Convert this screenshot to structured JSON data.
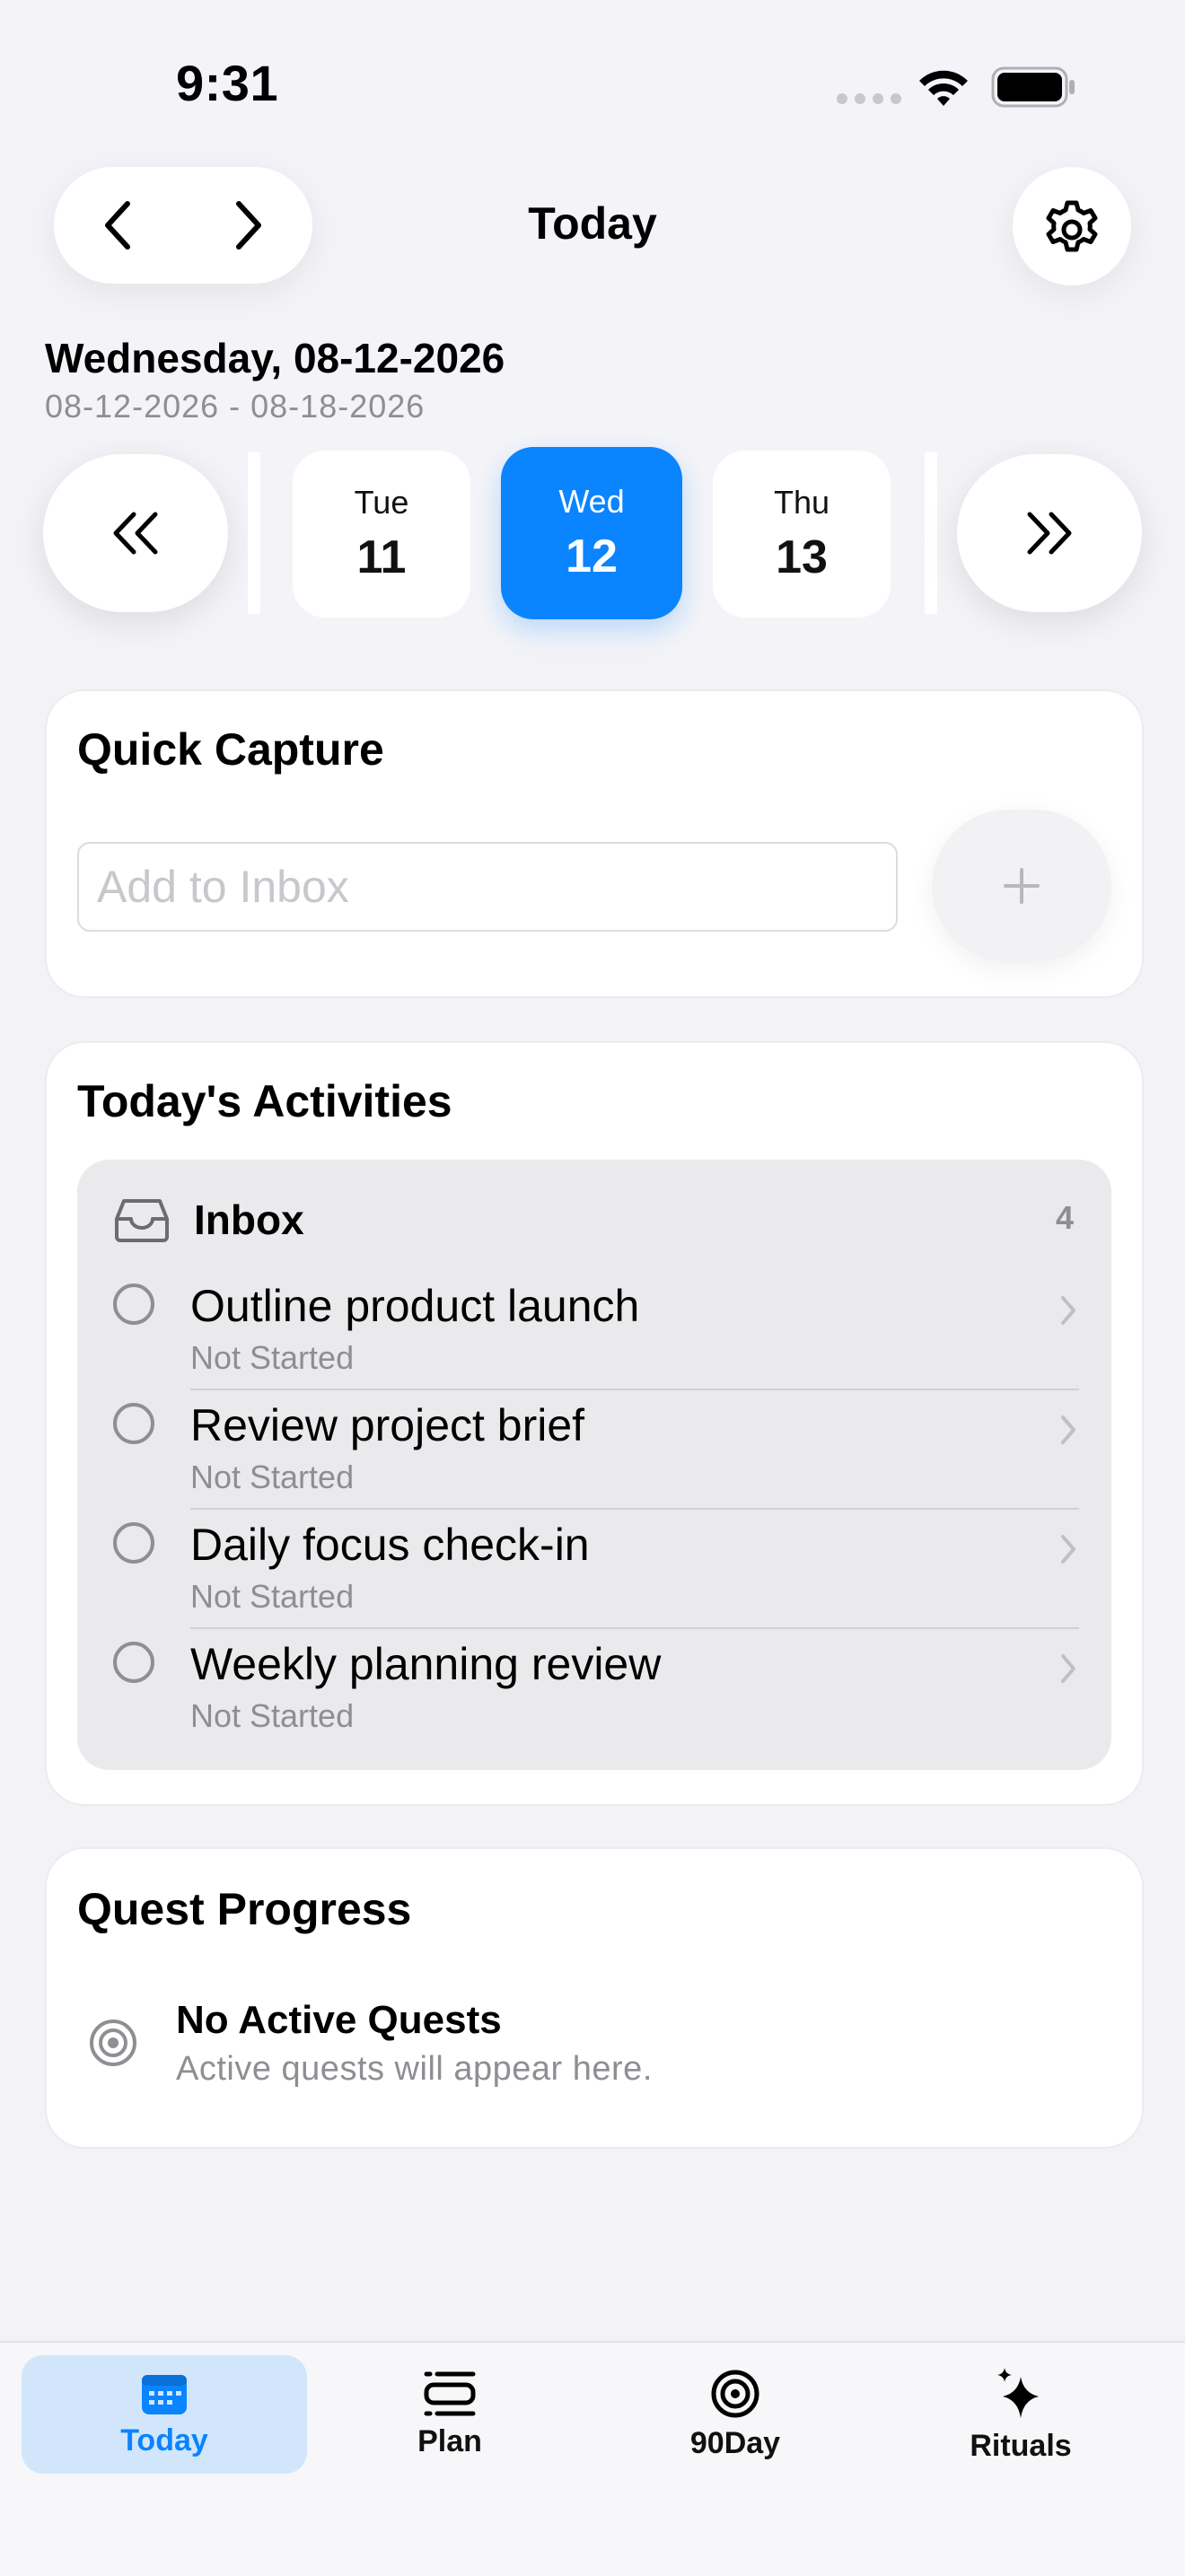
{
  "status": {
    "time": "9:31"
  },
  "header": {
    "title": "Today"
  },
  "date": {
    "title": "Wednesday, 08-12-2026",
    "range": "08-12-2026 - 08-18-2026"
  },
  "week": {
    "days": [
      {
        "name": "Tue",
        "num": "11"
      },
      {
        "name": "Wed",
        "num": "12",
        "selected": true
      },
      {
        "name": "Thu",
        "num": "13"
      }
    ]
  },
  "quick_capture": {
    "title": "Quick Capture",
    "placeholder": "Add to Inbox",
    "value": ""
  },
  "activities": {
    "title": "Today's Activities",
    "inbox": {
      "label": "Inbox",
      "count": "4"
    },
    "tasks": [
      {
        "name": "Outline product launch",
        "status": "Not Started"
      },
      {
        "name": "Review project brief",
        "status": "Not Started"
      },
      {
        "name": "Daily focus check-in",
        "status": "Not Started"
      },
      {
        "name": "Weekly planning review",
        "status": "Not Started"
      }
    ]
  },
  "quests": {
    "title": "Quest Progress",
    "empty_title": "No Active Quests",
    "empty_sub": "Active quests will appear here."
  },
  "tabs": [
    {
      "label": "Today",
      "icon": "calendar-icon",
      "active": true
    },
    {
      "label": "Plan",
      "icon": "plan-list-icon"
    },
    {
      "label": "90Day",
      "icon": "target-icon"
    },
    {
      "label": "Rituals",
      "icon": "sparkles-icon"
    }
  ],
  "colors": {
    "accent": "#0a84ff",
    "background": "#f2f2f7",
    "muted": "#8e8e93"
  }
}
